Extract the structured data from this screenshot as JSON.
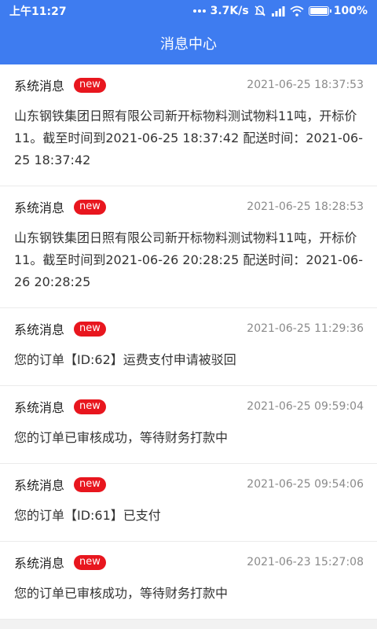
{
  "status_bar": {
    "time": "上午11:27",
    "network_speed": "3.7K/s",
    "battery": "100%",
    "icons": [
      "more-dots-icon",
      "mute-icon",
      "signal-icon",
      "wifi-icon",
      "battery-icon"
    ]
  },
  "header": {
    "title": "消息中心"
  },
  "colors": {
    "header_bg": "#3e7cf0",
    "badge_bg": "#e8161e"
  },
  "messages": [
    {
      "title": "系统消息",
      "badge": "new",
      "time": "2021-06-25 18:37:53",
      "body": "山东钢铁集团日照有限公司新开标物料测试物料11吨，开标价11。截至时间到2021-06-25 18:37:42 配送时间：2021-06-25 18:37:42"
    },
    {
      "title": "系统消息",
      "badge": "new",
      "time": "2021-06-25 18:28:53",
      "body": "山东钢铁集团日照有限公司新开标物料测试物料11吨，开标价11。截至时间到2021-06-26 20:28:25 配送时间：2021-06-26 20:28:25"
    },
    {
      "title": "系统消息",
      "badge": "new",
      "time": "2021-06-25 11:29:36",
      "body": "您的订单【ID:62】运费支付申请被驳回"
    },
    {
      "title": "系统消息",
      "badge": "new",
      "time": "2021-06-25 09:59:04",
      "body": "您的订单已审核成功，等待财务打款中"
    },
    {
      "title": "系统消息",
      "badge": "new",
      "time": "2021-06-25 09:54:06",
      "body": "您的订单【ID:61】已支付"
    },
    {
      "title": "系统消息",
      "badge": "new",
      "time": "2021-06-23 15:27:08",
      "body": "您的订单已审核成功，等待财务打款中"
    }
  ]
}
